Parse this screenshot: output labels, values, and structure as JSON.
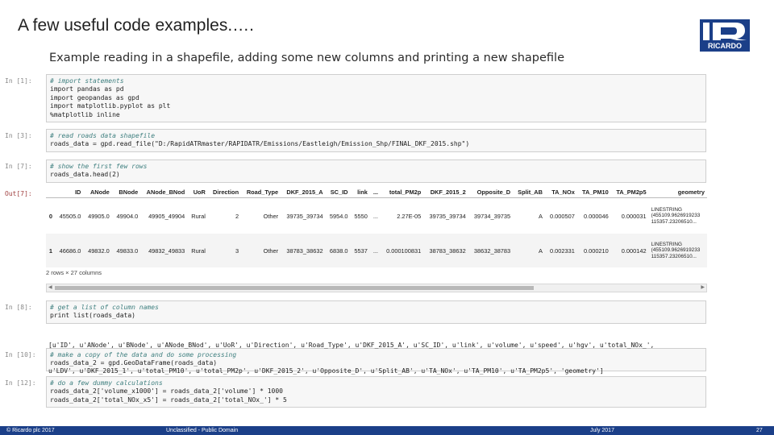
{
  "slide": {
    "title": "A few useful code examples.….",
    "logo_text": "RICARDO",
    "heading": "Example reading in a shapefile, adding some new columns and printing a new shapefile"
  },
  "cells": [
    {
      "prompt": "In [1]:",
      "lines": [
        {
          "text": "# import statements",
          "kind": "comment"
        },
        {
          "text": "import pandas as pd",
          "kind": "normal"
        },
        {
          "text": "import geopandas as gpd",
          "kind": "normal"
        },
        {
          "text": "import matplotlib.pyplot as plt",
          "kind": "normal"
        },
        {
          "text": "%matplotlib inline",
          "kind": "normal"
        }
      ]
    },
    {
      "prompt": "In [3]:",
      "lines": [
        {
          "text": "# read roads data shapefile",
          "kind": "comment"
        },
        {
          "text": "roads_data = gpd.read_file(\"D:/RapidATRmaster/RAPIDATR/Emissions/Eastleigh/Emission_Shp/FINAL_DKF_2015.shp\")",
          "kind": "normal"
        }
      ]
    },
    {
      "prompt": "In [7]:",
      "lines": [
        {
          "text": "# show the first few rows",
          "kind": "comment"
        },
        {
          "text": "roads_data.head(2)",
          "kind": "normal"
        }
      ]
    },
    {
      "prompt": "In [8]:",
      "lines": [
        {
          "text": "# get a list of column names",
          "kind": "comment"
        },
        {
          "text": "print list(roads_data)",
          "kind": "normal"
        }
      ]
    },
    {
      "prompt": "In [10]:",
      "lines": [
        {
          "text": "# make a copy of the data and do some processing",
          "kind": "comment"
        },
        {
          "text": "roads_data_2 = gpd.GeoDataFrame(roads_data)",
          "kind": "normal"
        }
      ]
    },
    {
      "prompt": "In [12]:",
      "lines": [
        {
          "text": "# do a few dummy calculations",
          "kind": "comment"
        },
        {
          "text": "roads_data_2['volume_x1000'] = roads_data_2['volume'] * 1000",
          "kind": "normal"
        },
        {
          "text": "roads_data_2['total_NOx_x5'] = roads_data_2['total_NOx_'] * 5",
          "kind": "normal"
        }
      ]
    }
  ],
  "output": {
    "prompt": "Out[7]:",
    "columns": [
      "",
      "ID",
      "ANode",
      "BNode",
      "ANode_BNod",
      "UoR",
      "Direction",
      "Road_Type",
      "DKF_2015_A",
      "SC_ID",
      "link",
      "...",
      "total_PM2p",
      "DKF_2015_2",
      "Opposite_D",
      "Split_AB",
      "TA_NOx",
      "TA_PM10",
      "TA_PM2p5",
      "geometry"
    ],
    "rows": [
      [
        "0",
        "45505.0",
        "49905.0",
        "49904.0",
        "49905_49904",
        "Rural",
        "2",
        "Other",
        "39735_39734",
        "5954.0",
        "5550",
        "...",
        "2.27E-05",
        "39735_39734",
        "39734_39735",
        "A",
        "0.000507",
        "0.000046",
        "0.000031",
        "LINESTRING\n(455109.9626919233\n115357.23206510..."
      ],
      [
        "1",
        "46686.0",
        "49832.0",
        "49833.0",
        "49832_49833",
        "Rural",
        "3",
        "Other",
        "38783_38632",
        "6838.0",
        "5537",
        "...",
        "0.000100831",
        "38783_38632",
        "38632_38783",
        "A",
        "0.002331",
        "0.000210",
        "0.000142",
        "LINESTRING\n(455109.9626919233\n115357.23206510..."
      ]
    ],
    "shape_note": "2 rows × 27 columns"
  },
  "stdout": {
    "lines": [
      "[u'ID', u'ANode', u'BNode', u'ANode_BNod', u'UoR', u'Direction', u'Road_Type', u'DKF_2015_A', u'SC_ID', u'link', u'volume', u'speed', u'hgv', u'total_NOx_',",
      "u'LDV', u'DKF_2015_1', u'total_PM10', u'total_PM2p', u'DKF_2015_2', u'Opposite_D', u'Split_AB', u'TA_NOx', u'TA_PM10', u'TA_PM2p5', 'geometry']"
    ]
  },
  "footer": {
    "copyright": "© Ricardo plc 2017",
    "classification": "Unclassified - Public Domain",
    "date": "July 2017",
    "page": "27"
  },
  "colors": {
    "footer_bg": "#1b3f88",
    "comment": "#408080",
    "cell_bg": "#f7f7f7"
  }
}
